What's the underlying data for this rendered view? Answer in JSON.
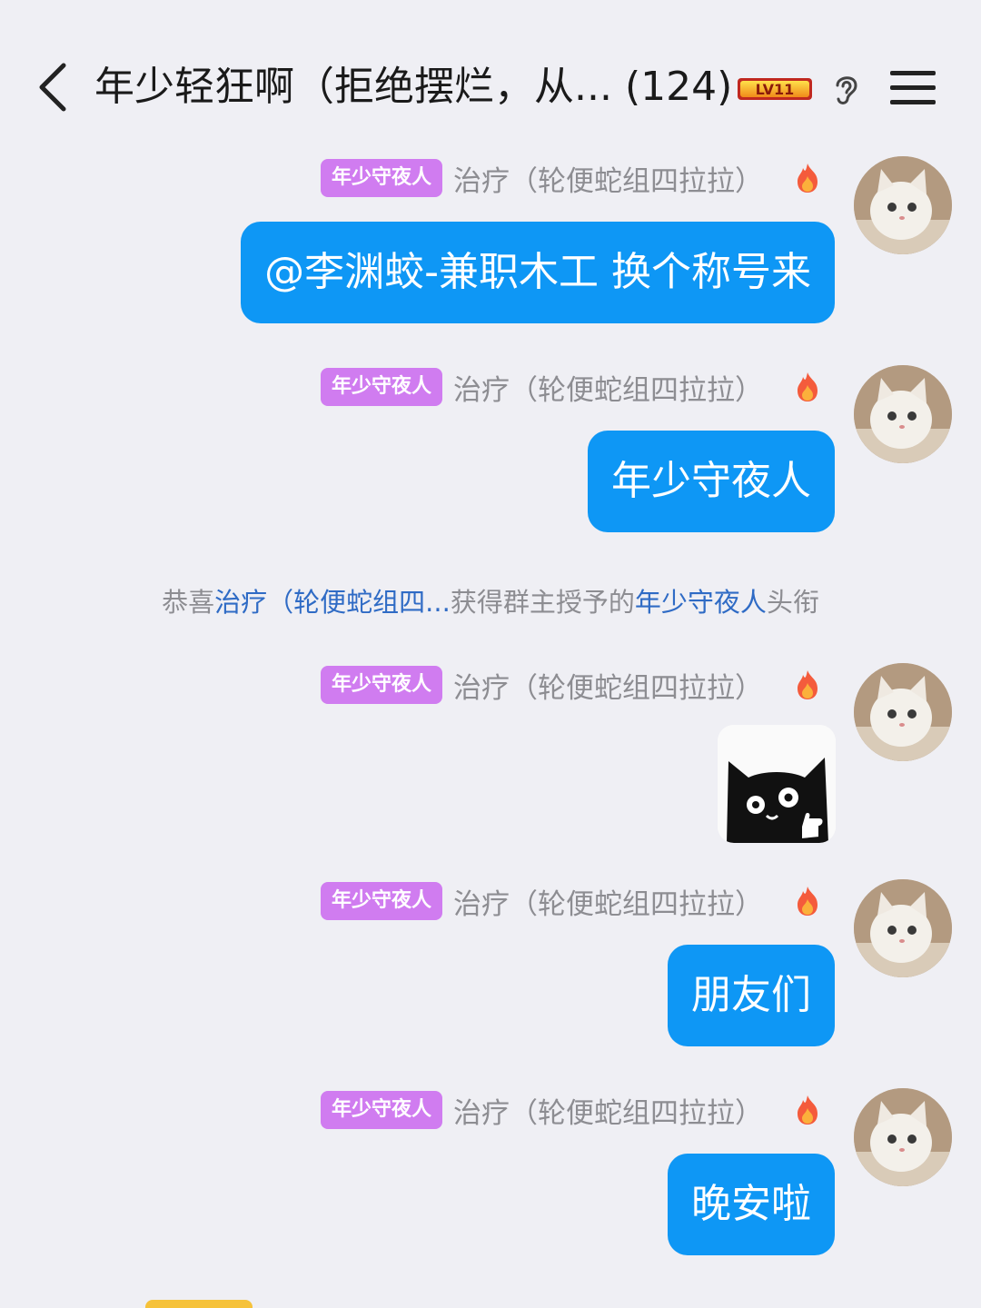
{
  "header": {
    "title": "年少轻狂啊（拒绝摆烂，从... (124)",
    "level_badge_text": "LV11",
    "colors": {
      "background": "#efeff4",
      "text": "#1a1a1a"
    },
    "icons": {
      "back": "chevron-left-icon",
      "ear": "ear-icon",
      "menu": "hamburger-menu-icon"
    }
  },
  "messages": [
    {
      "title_tag": "年少守夜人",
      "sender": "治疗（轮便蛇组四拉拉）",
      "type": "text",
      "text": "@李渊蛟-兼职木工 换个称号来"
    },
    {
      "title_tag": "年少守夜人",
      "sender": "治疗（轮便蛇组四拉拉）",
      "type": "text",
      "text": "年少守夜人"
    },
    {
      "title_tag": "年少守夜人",
      "sender": "治疗（轮便蛇组四拉拉）",
      "type": "sticker",
      "sticker": "black-cat-thumbs-up-sticker"
    },
    {
      "title_tag": "年少守夜人",
      "sender": "治疗（轮便蛇组四拉拉）",
      "type": "text",
      "text": "朋友们"
    },
    {
      "title_tag": "年少守夜人",
      "sender": "治疗（轮便蛇组四拉拉）",
      "type": "text",
      "text": "晚安啦"
    }
  ],
  "system_notice": {
    "prefix": "恭喜",
    "name": "治疗（轮便蛇组四...",
    "middle": "获得群主授予的",
    "title": "年少守夜人",
    "suffix": "头衔"
  },
  "colors": {
    "bubble": "#0e97f5",
    "title_tag": "#d07cf0",
    "highlight": "#2f6bc5",
    "meta_text": "#8d8d92"
  }
}
